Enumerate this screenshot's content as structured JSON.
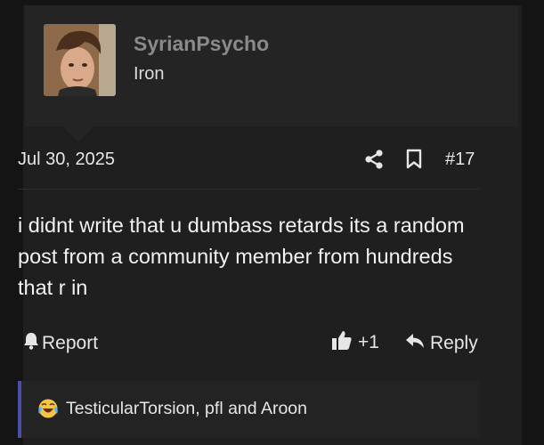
{
  "post": {
    "user": {
      "name": "SyrianPsycho",
      "title": "Iron",
      "avatar_icon": "user-photo"
    },
    "date": "Jul 30, 2025",
    "post_number": "#17",
    "message": "i didnt write that u dumbass retards its a random post from a community member from hundreds that r in",
    "actions": {
      "report_label": "Report",
      "like_count": "+1",
      "reply_label": "Reply"
    },
    "reactions": {
      "emoji_icon": "tears-of-joy-emoji",
      "text": "TesticularTorsion, pfl and Aroon"
    }
  },
  "colors": {
    "page_bg": "#141414",
    "post_bg": "#1f1f1f",
    "header_bg": "#242424",
    "username": "#8a8a8a",
    "reaction_accent": "#4a4fa8"
  }
}
